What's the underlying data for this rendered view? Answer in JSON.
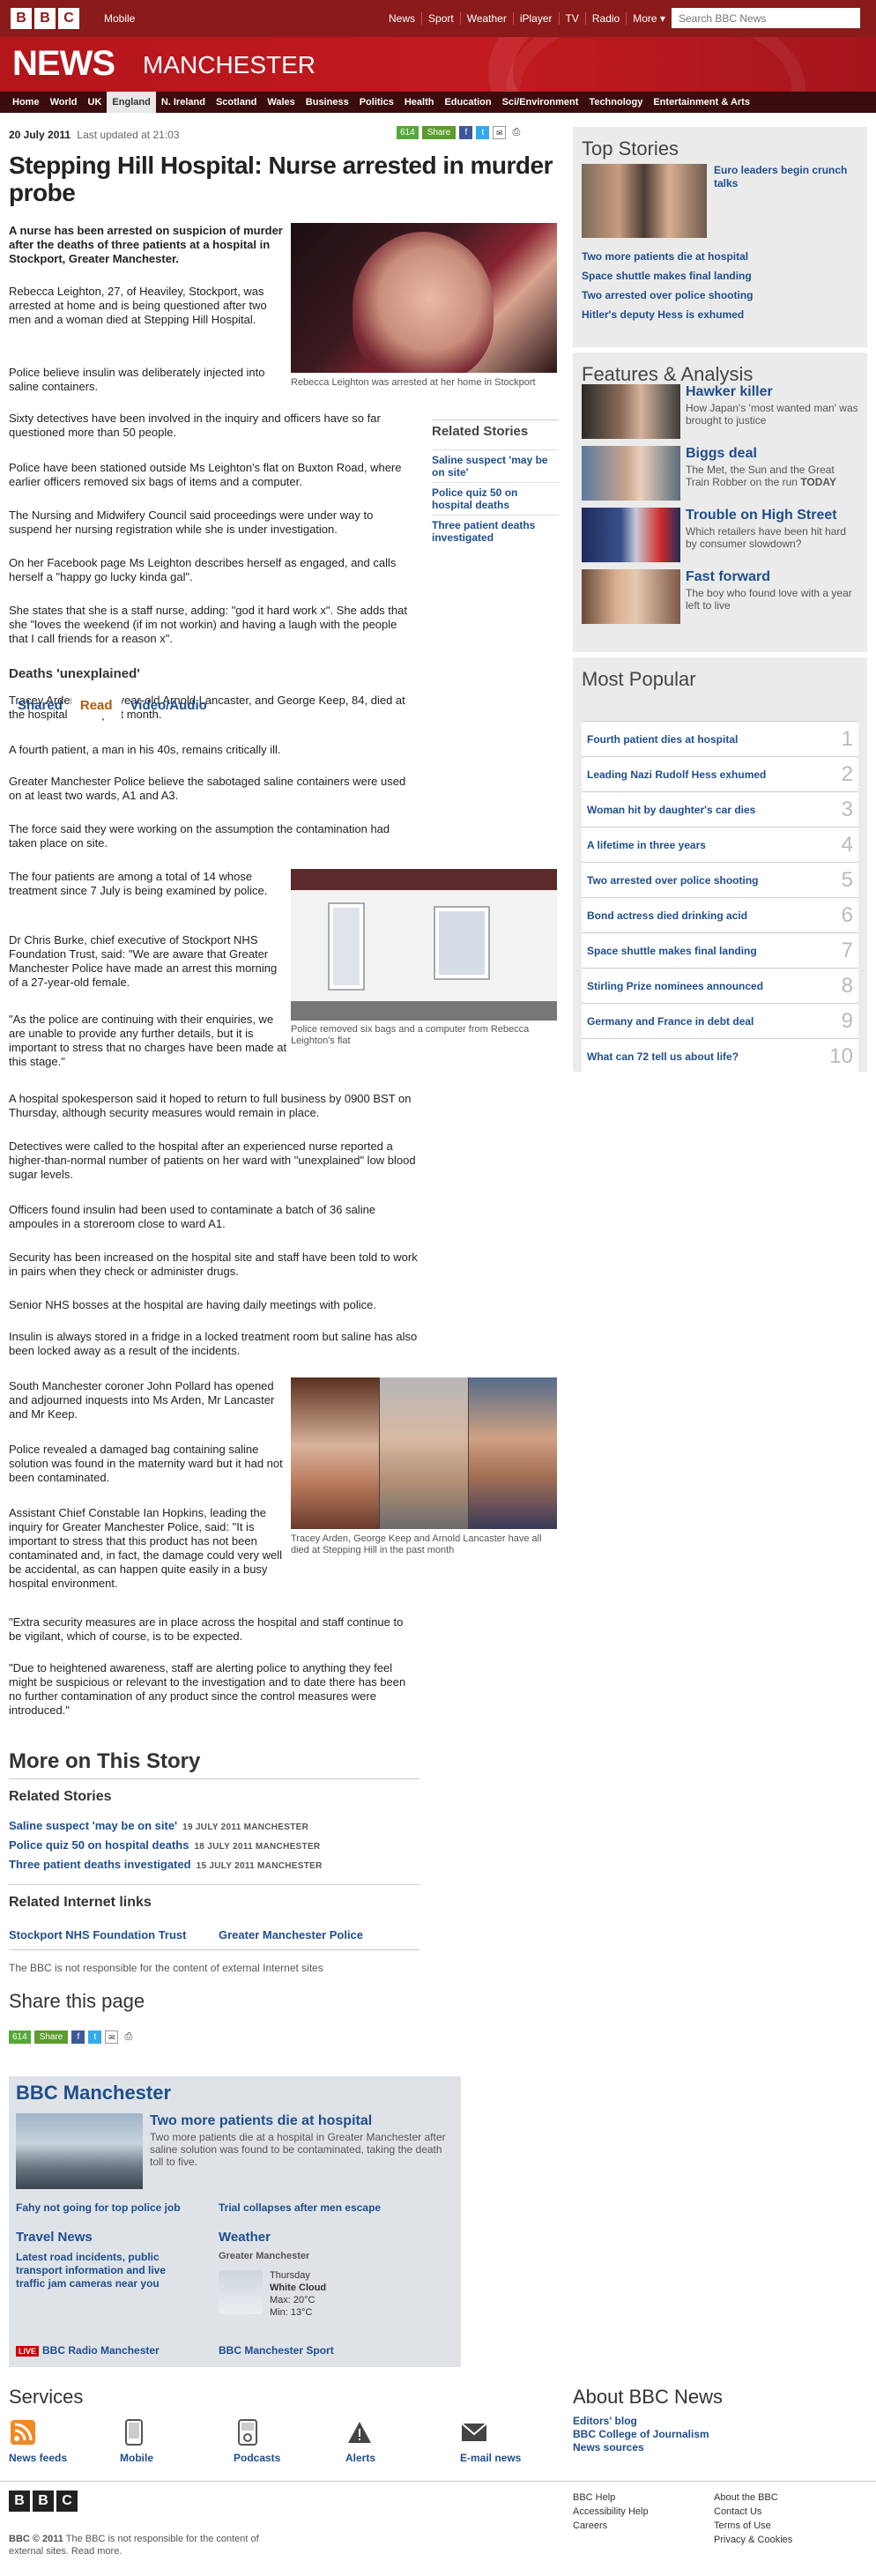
{
  "topbar": {
    "logo": [
      "B",
      "B",
      "C"
    ],
    "mobile": "Mobile",
    "nav": [
      "News",
      "Sport",
      "Weather",
      "iPlayer",
      "TV",
      "Radio",
      "More ▾"
    ],
    "search_placeholder": "Search BBC News"
  },
  "banner": {
    "news": "NEWS",
    "region": "MANCHESTER"
  },
  "sections": [
    "Home",
    "World",
    "UK",
    "England",
    "N. Ireland",
    "Scotland",
    "Wales",
    "Business",
    "Politics",
    "Health",
    "Education",
    "Sci/Environment",
    "Technology",
    "Entertainment & Arts"
  ],
  "article": {
    "date": "20 July 2011",
    "updated": "Last updated at 21:03",
    "share_count": "614",
    "share_label": "Share",
    "title": "Stepping Hill Hospital: Nurse arrested in murder probe",
    "intro": "A nurse has been arrested on suspicion of murder after the deaths of three patients at a hospital in Stockport, Greater Manchester.",
    "p1": "Rebecca Leighton, 27, of Heaviley, Stockport, was arrested at home and is being questioned after two men and a woman died at Stepping Hill Hospital.",
    "p2": "Police believe insulin was deliberately injected into saline containers.",
    "p3": "Sixty detectives have been involved in the inquiry and officers have so far questioned more than 50 people.",
    "p4": "Police have been stationed outside Ms Leighton's flat on Buxton Road, where earlier officers removed six bags of items and a computer.",
    "p5": "The Nursing and Midwifery Council said proceedings were under way to suspend her nursing registration while she is under investigation.",
    "p6": "On her Facebook page Ms Leighton describes herself as engaged, and calls herself a \"happy go lucky kinda gal\".",
    "p7": "She states that she is a staff nurse, adding: \"god it hard work x\". She adds that she \"loves the weekend (if im not workin) and having a laugh with the people that I call friends for a reason x\".",
    "subhead": "Deaths 'unexplained'",
    "p8": "Tracey Arden, 44, 71-year-old Arnold Lancaster, and George Keep, 84, died at the hospital in the past month.",
    "p9": "A fourth patient, a man in his 40s, remains critically ill.",
    "p10": "Greater Manchester Police believe the sabotaged saline containers were used on at least two wards, A1 and A3.",
    "p11": "The force said they were working on the assumption the contamination had taken place on site.",
    "p12": "The four patients are among a total of 14 whose treatment since 7 July is being examined by police.",
    "p13": "Dr Chris Burke, chief executive of Stockport NHS Foundation Trust, said: \"We are aware that Greater Manchester Police have made an arrest this morning of a 27-year-old female.",
    "p14": "\"As the police are continuing with their enquiries, we are unable to provide any further details, but it is important to stress that no charges have been made at this stage.\"",
    "p15": "A hospital spokesperson said it hoped to return to full business by 0900 BST on Thursday, although security measures would remain in place.",
    "p16": "Detectives were called to the hospital after an experienced nurse reported a higher-than-normal number of patients on her ward with \"unexplained\" low blood sugar levels.",
    "p17": "Officers found insulin had been used to contaminate a batch of 36 saline ampoules in a storeroom close to ward A1.",
    "p18": "Security has been increased on the hospital site and staff have been told to work in pairs when they check or administer drugs.",
    "p19": "Senior NHS bosses at the hospital are having daily meetings with police.",
    "p20": "Insulin is always stored in a fridge in a locked treatment room but saline has also been locked away as a result of the incidents.",
    "p21": "South Manchester coroner John Pollard has opened and adjourned inquests into Ms Arden, Mr Lancaster and Mr Keep.",
    "p22": "Police revealed a damaged bag containing saline solution was found in the maternity ward but it had not been contaminated.",
    "p23": "Assistant Chief Constable Ian Hopkins, leading the inquiry for Greater Manchester Police, said: \"It is important to stress that this product has not been contaminated and, in fact, the damage could very well be accidental, as can happen quite easily in a busy hospital environment.",
    "p24": "\"Extra security measures are in place across the hospital and staff continue to be vigilant, which of course, is to be expected.",
    "p25": "\"Due to heightened awareness, staff are alerting police to anything they feel might be suspicious or relevant to the investigation and to date there has been no further contamination of any product since the control measures were introduced.\"",
    "cap1": "Rebecca Leighton was arrested at her home in Stockport",
    "cap2": "Police removed six bags and a computer from Rebecca Leighton's flat",
    "cap3": "Tracey Arden, George Keep and Arnold Lancaster have all died at Stepping Hill in the past month"
  },
  "related_side": {
    "heading": "Related Stories",
    "links": [
      "Saline suspect 'may be on site'",
      "Police quiz 50 on hospital deaths",
      "Three patient deaths investigated"
    ]
  },
  "top_stories": {
    "heading": "Top Stories",
    "lead": "Euro leaders begin crunch talks",
    "links": [
      "Two more patients die at hospital",
      "Space shuttle makes final landing",
      "Two arrested over police shooting",
      "Hitler's deputy Hess is exhumed"
    ]
  },
  "features": {
    "heading": "Features & Analysis",
    "items": [
      {
        "title": "Hawker killer",
        "desc": "How Japan's 'most wanted man' was brought to justice"
      },
      {
        "title": "Biggs deal",
        "desc": "The Met, the Sun and the Great Train Robber on the run",
        "tag": "TODAY"
      },
      {
        "title": "Trouble on High Street",
        "desc": "Which retailers have been hit hard by consumer slowdown?"
      },
      {
        "title": "Fast forward",
        "desc": "The boy who found love with a year left to live"
      }
    ]
  },
  "most_popular": {
    "heading": "Most Popular",
    "tabs": [
      "Shared",
      "Read",
      "Video/Audio"
    ],
    "items": [
      {
        "title": "Fourth patient dies at hospital",
        "n": "1"
      },
      {
        "title": "Leading Nazi Rudolf Hess exhumed",
        "n": "2"
      },
      {
        "title": "Woman hit by daughter's car dies",
        "n": "3"
      },
      {
        "title": "A lifetime in three years",
        "n": "4"
      },
      {
        "title": "Two arrested over police shooting",
        "n": "5"
      },
      {
        "title": "Bond actress died drinking acid",
        "n": "6"
      },
      {
        "title": "Space shuttle makes final landing",
        "n": "7"
      },
      {
        "title": "Stirling Prize nominees announced",
        "n": "8"
      },
      {
        "title": "Germany and France in debt deal",
        "n": "9"
      },
      {
        "title": "What can 72 tell us about life?",
        "n": "10"
      }
    ]
  },
  "more_on_story": {
    "heading": "More on This Story",
    "related_heading": "Related Stories",
    "related": [
      {
        "title": "Saline suspect 'may be on site'",
        "date": "19 JULY 2011",
        "section": "MANCHESTER"
      },
      {
        "title": "Police quiz 50 on hospital deaths",
        "date": "18 JULY 2011",
        "section": "MANCHESTER"
      },
      {
        "title": "Three patient deaths investigated",
        "date": "15 JULY 2011",
        "section": "MANCHESTER"
      }
    ],
    "internet_heading": "Related Internet links",
    "internet_links": [
      "Stockport NHS Foundation Trust",
      "Greater Manchester Police"
    ],
    "disclaimer": "The BBC is not responsible for the content of external Internet sites"
  },
  "share_page": {
    "heading": "Share this page",
    "count": "614",
    "label": "Share"
  },
  "local": {
    "heading": "BBC Manchester",
    "lead_title": "Two more patients die at hospital",
    "lead_desc": "Two more patients die at a hospital in Greater Manchester after saline solution was found to be contaminated, taking the death toll to five.",
    "link_a": "Fahy not going for top police job",
    "link_b": "Trial collapses after men escape",
    "travel_heading": "Travel News",
    "travel_text": "Latest road incidents, public transport information and live traffic jam cameras near you",
    "weather_heading": "Weather",
    "weather_place": "Greater Manchester",
    "weather_day": "Thursday",
    "weather_desc": "White Cloud",
    "weather_max": "Max: 20°C",
    "weather_min": "Min: 13°C",
    "live": "LIVE",
    "radio": "BBC Radio Manchester",
    "sport": "BBC Manchester Sport"
  },
  "services": {
    "heading": "Services",
    "items": [
      "News feeds",
      "Mobile",
      "Podcasts",
      "Alerts",
      "E-mail news"
    ]
  },
  "about": {
    "heading": "About BBC News",
    "links": [
      "Editors' blog",
      "BBC College of Journalism",
      "News sources"
    ]
  },
  "footer": {
    "copyright": "BBC © 2011",
    "note": "The BBC is not responsible for the content of external sites. Read more.",
    "col1": [
      "BBC Help",
      "Accessibility Help",
      "Careers"
    ],
    "col2": [
      "About the BBC",
      "Contact Us",
      "Terms of Use",
      "Privacy & Cookies"
    ]
  }
}
